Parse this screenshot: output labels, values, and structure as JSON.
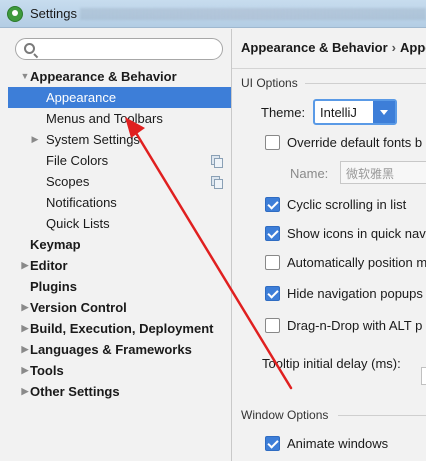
{
  "window": {
    "title": "Settings",
    "logo_icon": "intellij-settings-logo-icon"
  },
  "search": {
    "placeholder": "",
    "value": ""
  },
  "tree": [
    {
      "label": "Appearance & Behavior",
      "bold": true,
      "arrow": "▼"
    },
    {
      "label": "Appearance",
      "selected": true
    },
    {
      "label": "Menus and Toolbars"
    },
    {
      "label": "System Settings",
      "arrow": "▶"
    },
    {
      "label": "File Colors",
      "icon": "copy-icon"
    },
    {
      "label": "Scopes",
      "icon": "copy-icon"
    },
    {
      "label": "Notifications"
    },
    {
      "label": "Quick Lists"
    },
    {
      "label": "Keymap",
      "bold": true
    },
    {
      "label": "Editor",
      "bold": true,
      "arrow": "▶"
    },
    {
      "label": "Plugins",
      "bold": true
    },
    {
      "label": "Version Control",
      "bold": true,
      "arrow": "▶"
    },
    {
      "label": "Build, Execution, Deployment",
      "bold": true,
      "arrow": "▶"
    },
    {
      "label": "Languages & Frameworks",
      "bold": true,
      "arrow": "▶"
    },
    {
      "label": "Tools",
      "bold": true,
      "arrow": "▶"
    },
    {
      "label": "Other Settings",
      "bold": true,
      "arrow": "▶"
    }
  ],
  "breadcrumb": {
    "parent": "Appearance & Behavior",
    "separator": "›",
    "current": "Appe"
  },
  "ui_options": {
    "section_title": "UI Options",
    "theme_label": "Theme:",
    "theme_value": "IntelliJ",
    "override_fonts_label": "Override default fonts b",
    "name_label": "Name:",
    "name_value": "微软雅黑",
    "checkboxes": [
      {
        "label": "Cyclic scrolling in list",
        "checked": true
      },
      {
        "label": "Show icons in quick navi",
        "checked": true
      },
      {
        "label": "Automatically position m",
        "checked": false
      },
      {
        "label": "Hide navigation popups",
        "checked": true
      },
      {
        "label": "Drag-n-Drop with ALT p",
        "checked": false
      }
    ],
    "tooltip_label": "Tooltip initial delay (ms):"
  },
  "window_options": {
    "section_title": "Window Options",
    "animate_windows_label": "Animate windows",
    "animate_windows_checked": true
  },
  "colors": {
    "selection": "#3d7ed8",
    "annotation_arrow": "#e02020"
  }
}
